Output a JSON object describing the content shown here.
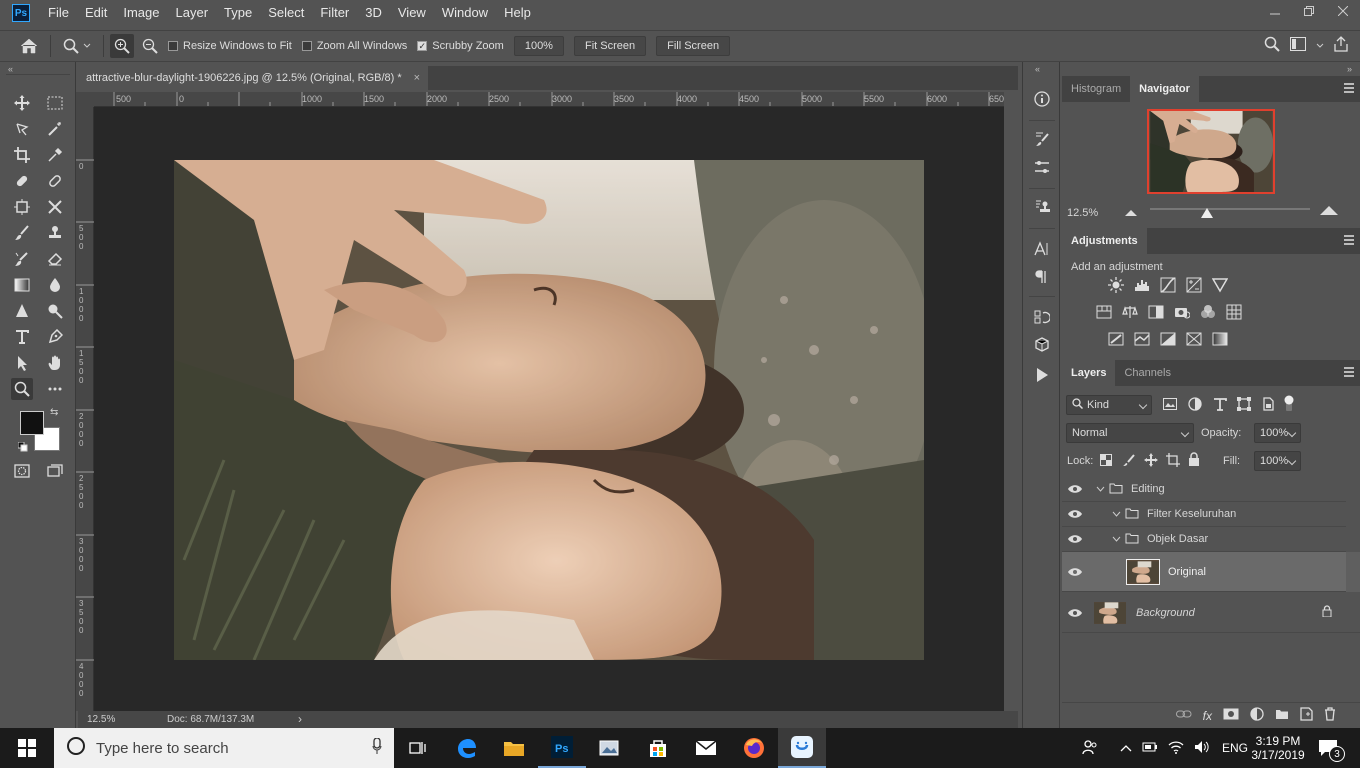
{
  "app": {
    "logo": "Ps"
  },
  "menu": [
    "File",
    "Edit",
    "Image",
    "Layer",
    "Type",
    "Select",
    "Filter",
    "3D",
    "View",
    "Window",
    "Help"
  ],
  "window_controls": {
    "minimize_icon": "minimize-icon",
    "restore_icon": "restore-icon",
    "close_icon": "close-icon"
  },
  "options": {
    "resize_windows": {
      "label": "Resize Windows to Fit",
      "checked": false
    },
    "zoom_all": {
      "label": "Zoom All Windows",
      "checked": false
    },
    "scrubby_zoom": {
      "label": "Scrubby Zoom",
      "checked": true
    },
    "zoom_value": "100%",
    "fit_screen": "Fit Screen",
    "fill_screen": "Fill Screen"
  },
  "document": {
    "tab_title": "attractive-blur-daylight-1906226.jpg @ 12.5% (Original, RGB/8) *",
    "close_glyph": "×",
    "zoom": "12.5%",
    "doc_size": "Doc: 68.7M/137.3M",
    "status_arrow": "›"
  },
  "ruler": {
    "top_labels": [
      "500",
      "0",
      "1000",
      "1500",
      "2000",
      "2500",
      "3000",
      "3500",
      "4000",
      "4500",
      "5000",
      "5500",
      "6000",
      "650"
    ],
    "left_labels": [
      "0",
      "5 0 0",
      "1 0 0 0",
      "1 5 0 0",
      "2 0 0 0",
      "2 5 0 0",
      "3 0 0 0",
      "3 5 0 0",
      "4 0 0 0"
    ]
  },
  "navigator": {
    "tabs": [
      "Histogram",
      "Navigator"
    ],
    "zoom": "12.5%"
  },
  "adjustments": {
    "title": "Adjustments",
    "subtitle": "Add an adjustment"
  },
  "layers_panel": {
    "tabs": [
      "Layers",
      "Channels"
    ],
    "kind": "Kind",
    "blend_mode": "Normal",
    "opacity_label": "Opacity:",
    "opacity": "100%",
    "lock_label": "Lock:",
    "fill_label": "Fill:",
    "fill": "100%",
    "layers": [
      {
        "name": "Editing",
        "type": "group",
        "level": 0
      },
      {
        "name": "Filter Keseluruhan",
        "type": "group",
        "level": 1
      },
      {
        "name": "Objek Dasar",
        "type": "group",
        "level": 1
      },
      {
        "name": "Original",
        "type": "pixel",
        "selected": true
      },
      {
        "name": "Background",
        "type": "background"
      }
    ]
  },
  "taskbar": {
    "search_placeholder": "Type here to search",
    "language": "ENG",
    "time": "3:19 PM",
    "date": "3/17/2019",
    "notifications": "3"
  },
  "colors": {
    "accent": "#31a8ff",
    "panel": "#535353",
    "canvas_bg": "#282828",
    "navigator_frame": "#e0402e"
  }
}
